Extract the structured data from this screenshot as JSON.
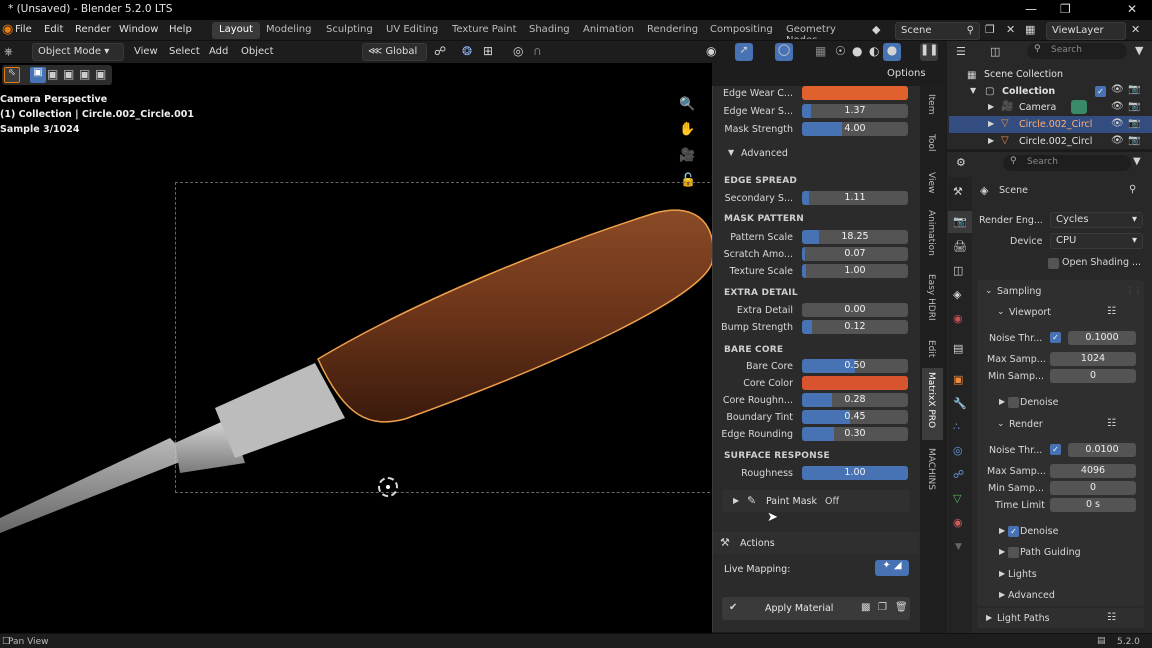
{
  "window": {
    "title": "* (Unsaved) - Blender 5.2.0 LTS"
  },
  "menu": {
    "items": [
      "File",
      "Edit",
      "Render",
      "Window",
      "Help"
    ]
  },
  "workspaces": [
    "Layout",
    "Modeling",
    "Sculpting",
    "UV Editing",
    "Texture Paint",
    "Shading",
    "Animation",
    "Rendering",
    "Compositing",
    "Geometry Nodes"
  ],
  "scene_name": "Scene",
  "view_layer": "ViewLayer",
  "header": {
    "mode": "Object Mode",
    "view": "View",
    "select": "Select",
    "add": "Add",
    "object": "Object",
    "orientation": "Global",
    "options": "Options"
  },
  "overlay": {
    "line1": "Camera Perspective",
    "line2": "(1) Collection | Circle.002_Circle.001",
    "line3": "Sample 3/1024"
  },
  "outliner": {
    "search_placeholder": "Search",
    "root": "Scene Collection",
    "collection": "Collection",
    "items": [
      "Camera",
      "Circle.002_Circl",
      "Circle.002_Circl"
    ]
  },
  "npanel": {
    "top_rows": [
      {
        "label": "Edge Wear C...",
        "value": "",
        "fill": 1.0,
        "color": "#e0612e"
      },
      {
        "label": "Edge Wear S...",
        "value": "1.37",
        "fill": 0.08
      },
      {
        "label": "Mask Strength",
        "value": "4.00",
        "fill": 0.38
      }
    ],
    "advanced": "Advanced",
    "sections": [
      {
        "title": "EDGE SPREAD",
        "rows": [
          {
            "label": "Secondary S...",
            "value": "1.11",
            "fill": 0.06
          }
        ]
      },
      {
        "title": "MASK PATTERN",
        "rows": [
          {
            "label": "Pattern Scale",
            "value": "18.25",
            "fill": 0.16
          },
          {
            "label": "Scratch Amo...",
            "value": "0.07",
            "fill": 0.03
          },
          {
            "label": "Texture Scale",
            "value": "1.00",
            "fill": 0.04
          }
        ]
      },
      {
        "title": "EXTRA DETAIL",
        "rows": [
          {
            "label": "Extra Detail",
            "value": "0.00",
            "fill": 0.0
          },
          {
            "label": "Bump Strength",
            "value": "0.12",
            "fill": 0.09
          }
        ]
      },
      {
        "title": "BARE CORE",
        "rows": [
          {
            "label": "Bare Core",
            "value": "0.50",
            "fill": 0.5
          },
          {
            "label": "Core Color",
            "value": "",
            "fill": 1.0,
            "color": "#d8542e"
          },
          {
            "label": "Core Roughn...",
            "value": "0.28",
            "fill": 0.28
          },
          {
            "label": "Boundary Tint",
            "value": "0.45",
            "fill": 0.45
          },
          {
            "label": "Edge Rounding",
            "value": "0.30",
            "fill": 0.3
          }
        ]
      },
      {
        "title": "SURFACE RESPONSE",
        "rows": [
          {
            "label": "Roughness",
            "value": "1.00",
            "fill": 1.0
          }
        ]
      }
    ],
    "paint_mask": "Paint Mask",
    "paint_mask_state": "Off",
    "actions": "Actions",
    "live_mapping": "Live Mapping:",
    "apply_material": "Apply Material"
  },
  "side_tabs": [
    "Item",
    "Tool",
    "View",
    "Animation",
    "Easy HDRI",
    "Edit",
    "MatrixX PRO",
    "MACHINS"
  ],
  "props": {
    "search_placeholder": "Search",
    "scene": "Scene",
    "render_engine_label": "Render Eng...",
    "render_engine": "Cycles",
    "device_label": "Device",
    "device": "CPU",
    "open_shading": "Open Shading ...",
    "sampling": "Sampling",
    "viewport": "Viewport",
    "noise_thr": "Noise Thr...",
    "vp_noise": "0.1000",
    "max_samp": "Max Samp...",
    "vp_max": "1024",
    "min_samp": "Min Samp...",
    "vp_min": "0",
    "denoise": "Denoise",
    "render": "Render",
    "r_noise": "0.0100",
    "r_max": "4096",
    "r_min": "0",
    "time_limit": "Time Limit",
    "r_time": "0 s",
    "path_guiding": "Path Guiding",
    "lights": "Lights",
    "advanced": "Advanced",
    "light_paths": "Light Paths"
  },
  "status": {
    "left": "Pan View",
    "version": "5.2.0"
  },
  "colors": {
    "accent": "#4772b3",
    "orange": "#e0612e",
    "selection": "#334d80"
  }
}
